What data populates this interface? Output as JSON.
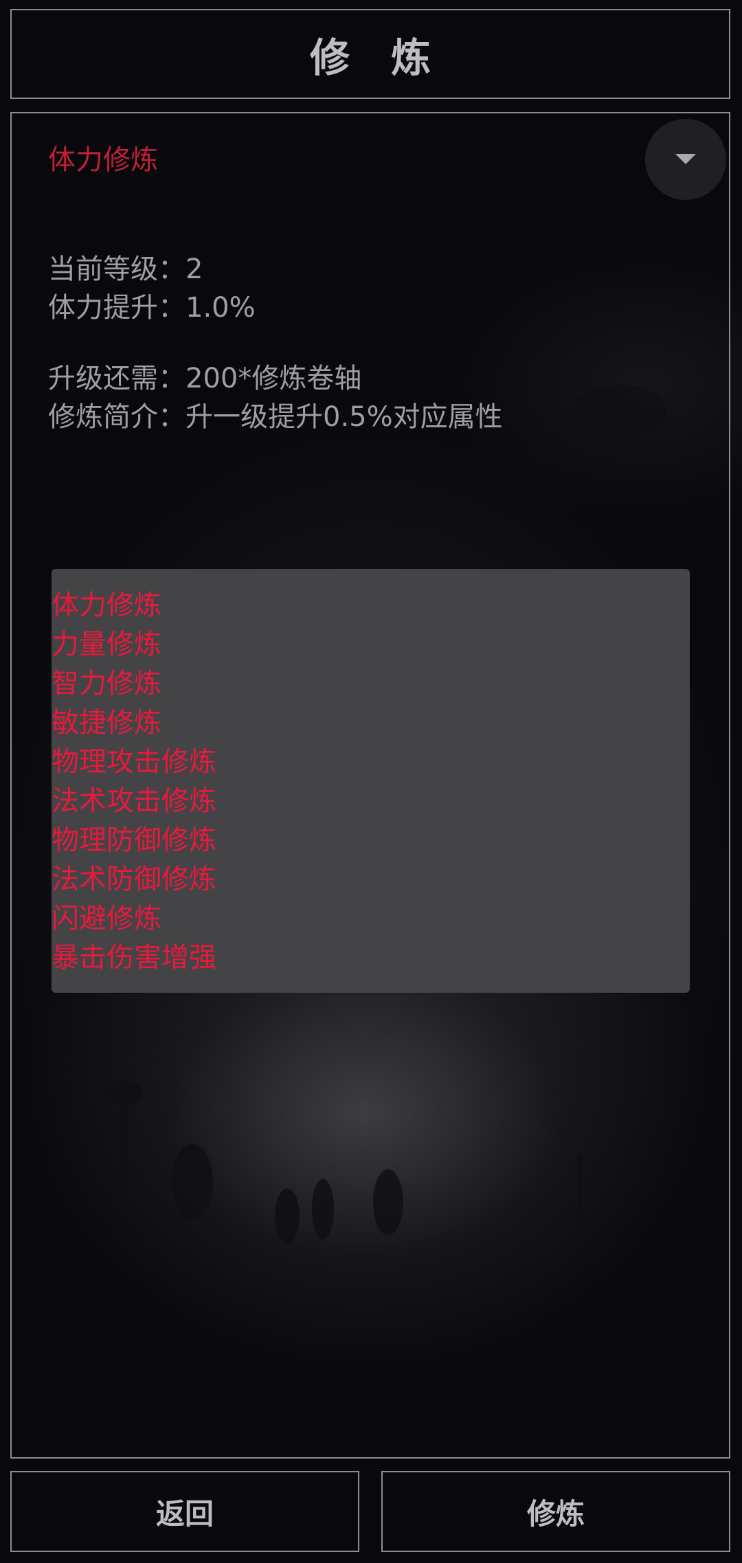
{
  "header": {
    "title": "修炼"
  },
  "selected": {
    "label": "体力修炼"
  },
  "info": {
    "level_label": "当前等级：",
    "level_value": "2",
    "boost_label": "体力提升：",
    "boost_value": "1.0%",
    "cost_label": "升级还需：",
    "cost_value": "200*修炼卷轴",
    "desc_label": "修炼简介：",
    "desc_value": "升一级提升0.5%对应属性"
  },
  "dropdown": {
    "options": [
      "体力修炼",
      "力量修炼",
      "智力修炼",
      "敏捷修炼",
      "物理攻击修炼",
      "法术攻击修炼",
      "物理防御修炼",
      "法术防御修炼",
      "闪避修炼",
      "暴击伤害增强"
    ]
  },
  "buttons": {
    "back_label": "返回",
    "train_label": "修炼"
  },
  "colors": {
    "background": "#09090d",
    "accent_red": "#e8193c",
    "label_red": "#c21f36",
    "border": "#8c8c94",
    "text_gray": "#9e9ea4",
    "dropdown_bg": "#444446"
  },
  "icons": {
    "dropdown": "caret-down-icon"
  }
}
